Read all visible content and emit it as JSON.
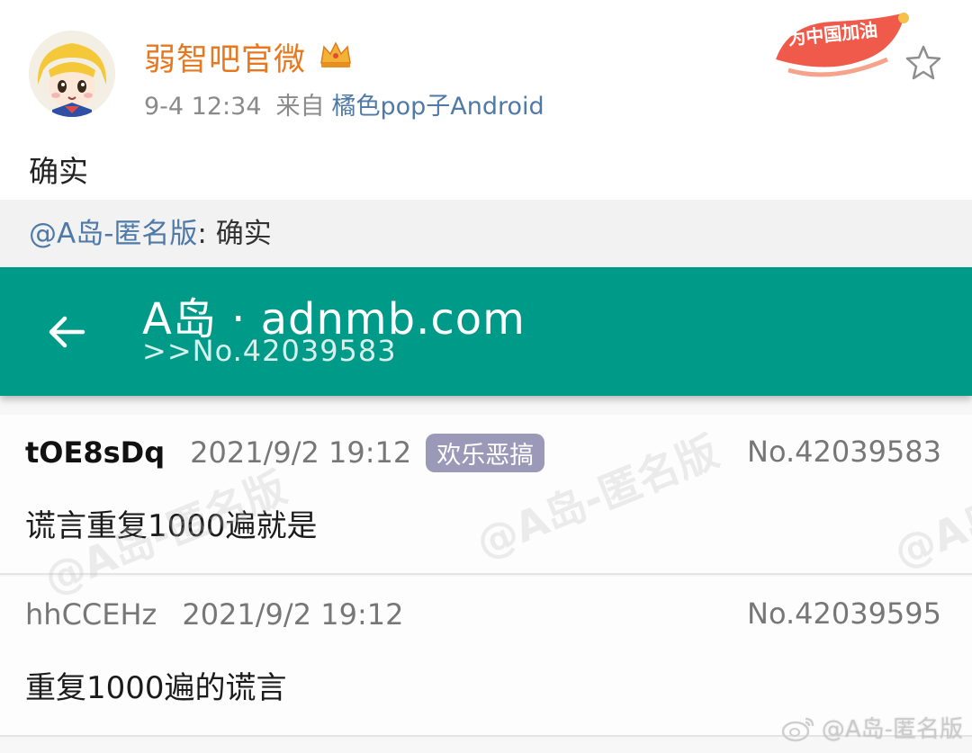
{
  "post": {
    "user_name": "弱智吧官微",
    "date": "9-4 12:34",
    "source_label": "来自",
    "source_app": "橘色pop子Android",
    "badge_text": "为中国加油",
    "text": "确实"
  },
  "repost": {
    "mention": "@A岛-匿名版",
    "separator": ":",
    "text": " 确实"
  },
  "app": {
    "title": "A岛 · adnmb.com",
    "subtitle": ">>No.42039583",
    "replies": [
      {
        "uid": "tOE8sDq",
        "time": "2021/9/2 19:12",
        "tag": "欢乐恶搞",
        "no": "No.42039583",
        "body": "谎言重复1000遍就是"
      },
      {
        "uid": "hhCCEHz",
        "time": "2021/9/2 19:12",
        "no": "No.42039595",
        "body": "重复1000遍的谎言"
      }
    ]
  },
  "watermarks": {
    "text_1": "@A岛-匿名版",
    "text_2": "@A岛-匿名版",
    "text_3": "@A岛",
    "footer": "@A岛-匿名版"
  }
}
